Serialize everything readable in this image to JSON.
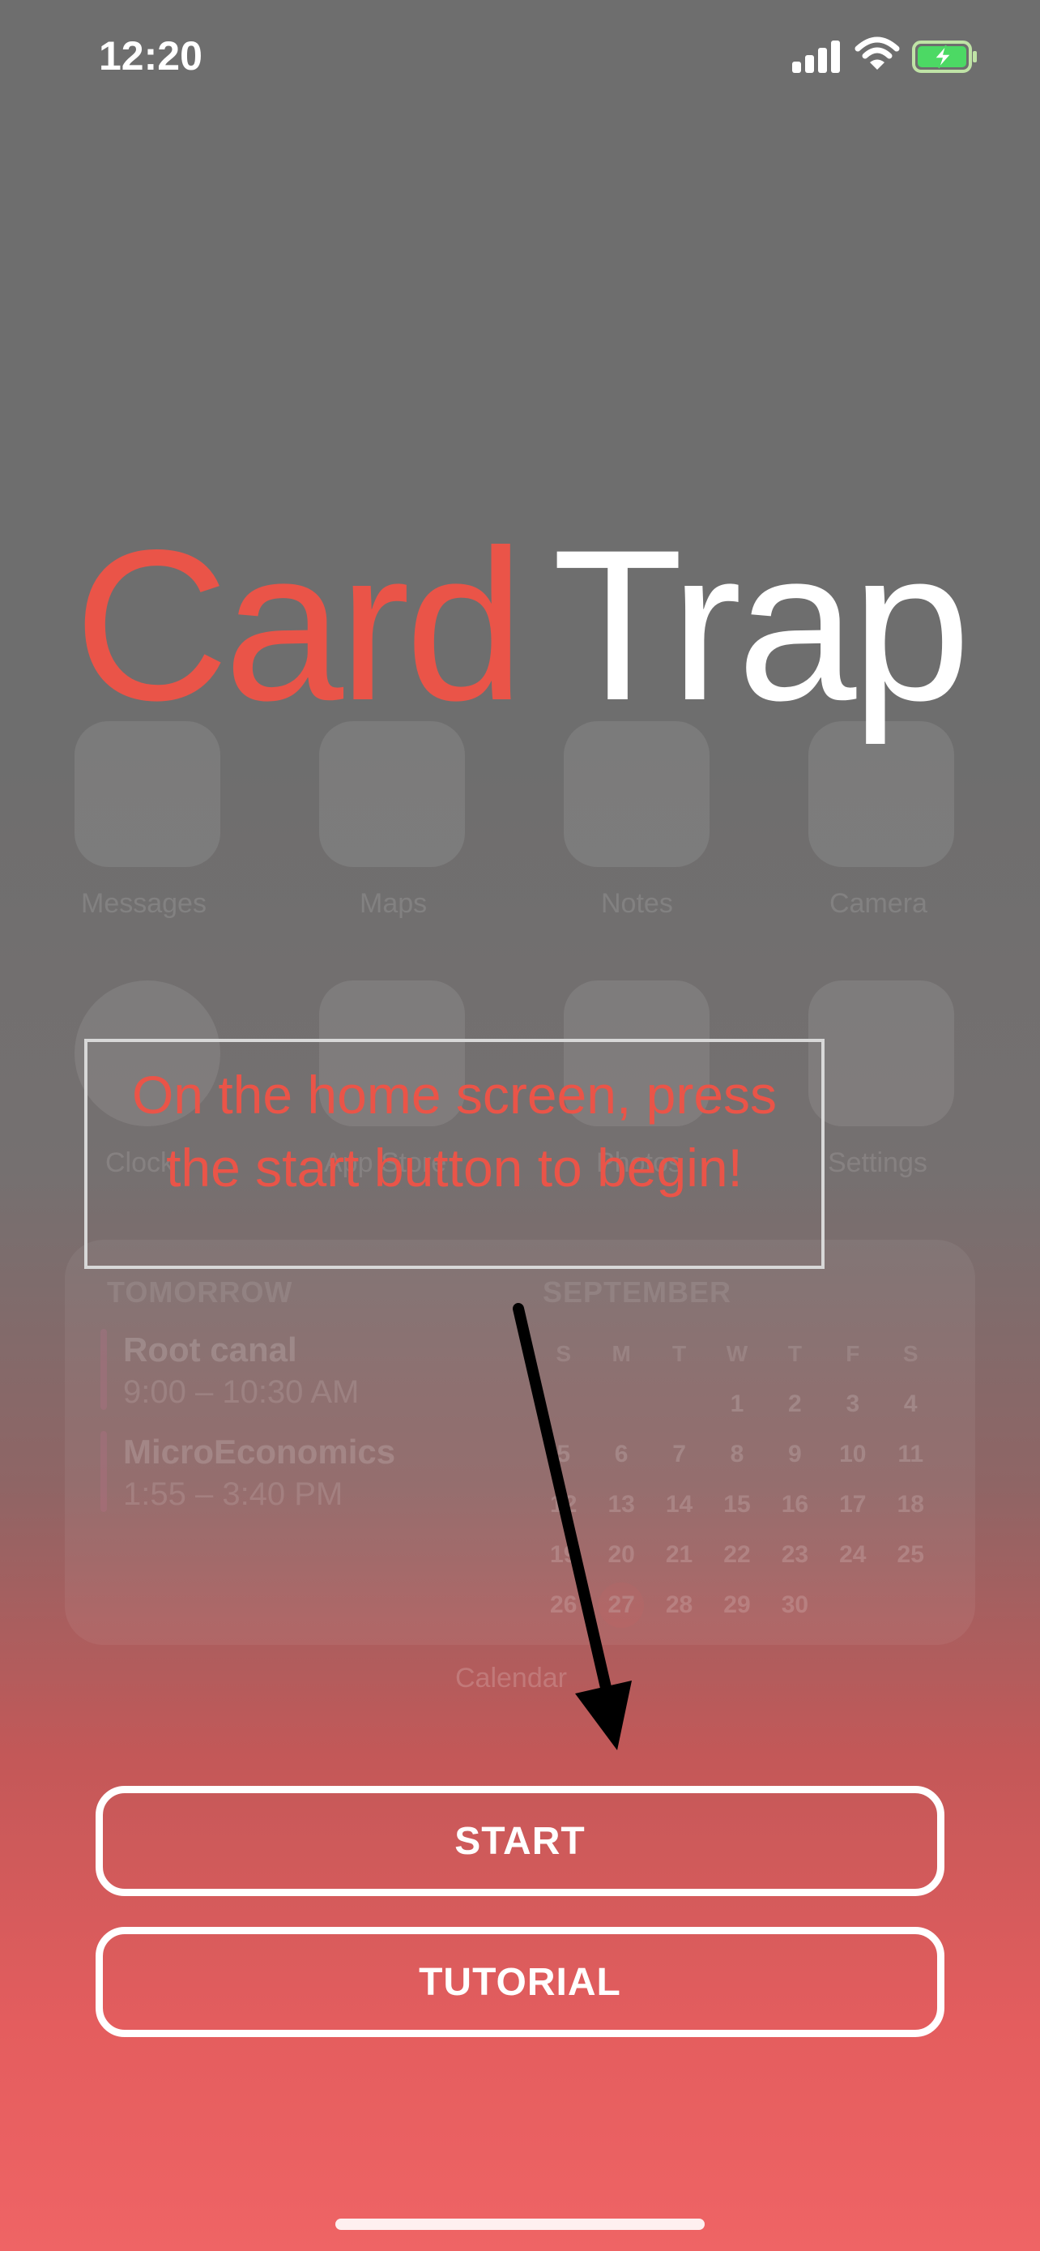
{
  "status_bar": {
    "time": "12:20"
  },
  "title": {
    "part1": "Card",
    "part2": "Trap"
  },
  "tutorial": {
    "tip": "On the home screen, press the start button to begin!"
  },
  "buttons": {
    "start": "START",
    "tutorial": "TUTORIAL"
  },
  "background": {
    "apps": [
      "Messages",
      "Maps",
      "Notes",
      "Camera",
      "Clock",
      "App Store",
      "Photos",
      "Settings"
    ],
    "widget": {
      "label": "Calendar",
      "left_title": "TOMORROW",
      "events": [
        {
          "name": "Root canal",
          "time": "9:00 – 10:30 AM"
        },
        {
          "name": "MicroEconomics",
          "time": "1:55 – 3:40 PM"
        }
      ],
      "month": "SEPTEMBER",
      "weekdays": [
        "S",
        "M",
        "T",
        "W",
        "T",
        "F",
        "S"
      ],
      "weeks": [
        [
          "",
          "",
          "",
          "1",
          "2",
          "3",
          "4"
        ],
        [
          "5",
          "6",
          "7",
          "8",
          "9",
          "10",
          "11"
        ],
        [
          "12",
          "13",
          "14",
          "15",
          "16",
          "17",
          "18"
        ],
        [
          "19",
          "20",
          "21",
          "22",
          "23",
          "24",
          "25"
        ],
        [
          "26",
          "27",
          "28",
          "29",
          "30",
          "",
          ""
        ]
      ],
      "today": "27"
    }
  },
  "colors": {
    "accent": "#ea5448",
    "text": "#ffffff",
    "box_border": "#d8d8d8"
  },
  "icons": [
    "cellular-signal-icon",
    "wifi-icon",
    "battery-charging-icon",
    "arrow-icon"
  ]
}
